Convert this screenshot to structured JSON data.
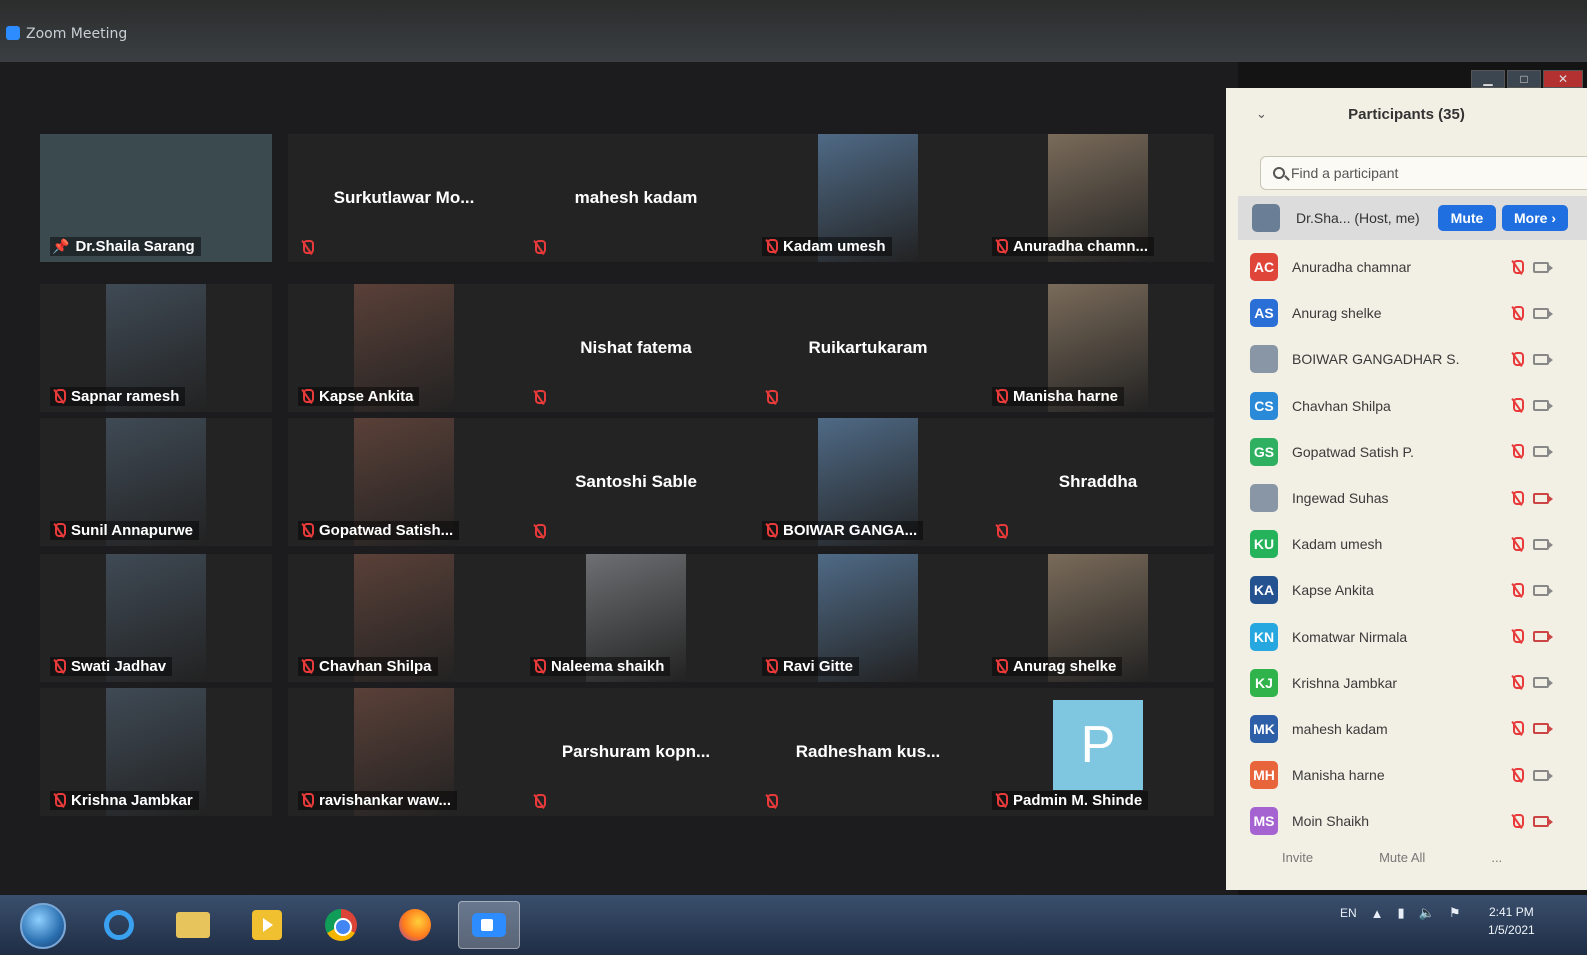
{
  "window": {
    "title": "Zoom Meeting",
    "minimize": "▁",
    "maximize": "□",
    "close": "✕"
  },
  "tiles": [
    {
      "name": "Dr.Shaila Sarang",
      "video": true,
      "active": true,
      "pinned": true
    },
    {
      "name": "Surkutlawar  Mo...",
      "video": false
    },
    {
      "name": "mahesh kadam",
      "video": false
    },
    {
      "name": "Kadam umesh",
      "video": true
    },
    {
      "name": "Anuradha chamn...",
      "video": true
    },
    {
      "name": "Sapnar ramesh",
      "video": true
    },
    {
      "name": "Kapse Ankita",
      "video": true
    },
    {
      "name": "Nishat fatema",
      "video": false
    },
    {
      "name": "Ruikartukaram",
      "video": false
    },
    {
      "name": "Manisha harne",
      "video": true
    },
    {
      "name": "Sunil Annapurwe",
      "video": true
    },
    {
      "name": "Gopatwad Satish...",
      "video": true
    },
    {
      "name": "Santoshi Sable",
      "video": false
    },
    {
      "name": "BOIWAR GANGA...",
      "video": true
    },
    {
      "name": "Shraddha",
      "video": false
    },
    {
      "name": "Swati Jadhav",
      "video": true
    },
    {
      "name": "Chavhan Shilpa",
      "video": true
    },
    {
      "name": "Naleema shaikh",
      "video": true
    },
    {
      "name": "Ravi Gitte",
      "video": true
    },
    {
      "name": "Anurag shelke",
      "video": true
    },
    {
      "name": "Krishna Jambkar",
      "video": true
    },
    {
      "name": "ravishankar waw...",
      "video": true
    },
    {
      "name": "Parshuram  kopn...",
      "video": false
    },
    {
      "name": "Radhesham  kus...",
      "video": false
    },
    {
      "name": "Padmin M. Shinde",
      "video": false,
      "avatar_letter": "P"
    }
  ],
  "panel": {
    "title": "Participants (35)",
    "search_placeholder": "Find a participant",
    "host": {
      "name": "Dr.Sha...  (Host, me)",
      "mute_label": "Mute",
      "more_label": "More ›"
    },
    "participants": [
      {
        "initials": "AC",
        "name": "Anuradha chamnar",
        "color": "#e0453a",
        "cam_off": false
      },
      {
        "initials": "AS",
        "name": "Anurag shelke",
        "color": "#2a6fd6",
        "cam_off": false
      },
      {
        "initials": "",
        "name": "BOIWAR GANGADHAR S.",
        "color": "#8896a6",
        "cam_off": false
      },
      {
        "initials": "CS",
        "name": "Chavhan Shilpa",
        "color": "#2a8ad8",
        "cam_off": false
      },
      {
        "initials": "GS",
        "name": "Gopatwad Satish P.",
        "color": "#2fb060",
        "cam_off": false
      },
      {
        "initials": "",
        "name": "Ingewad Suhas",
        "color": "#8896a6",
        "cam_off": true
      },
      {
        "initials": "KU",
        "name": "Kadam umesh",
        "color": "#24b35a",
        "cam_off": false
      },
      {
        "initials": "KA",
        "name": "Kapse Ankita",
        "color": "#24518f",
        "cam_off": false
      },
      {
        "initials": "KN",
        "name": "Komatwar Nirmala",
        "color": "#26a7e0",
        "cam_off": true
      },
      {
        "initials": "KJ",
        "name": "Krishna Jambkar",
        "color": "#2fb34a",
        "cam_off": false
      },
      {
        "initials": "MK",
        "name": "mahesh kadam",
        "color": "#2c5fa8",
        "cam_off": true
      },
      {
        "initials": "MH",
        "name": "Manisha harne",
        "color": "#e8643a",
        "cam_off": false
      },
      {
        "initials": "MS",
        "name": "Moin Shaikh",
        "color": "#a463d0",
        "cam_off": true
      }
    ],
    "footer": {
      "invite": "Invite",
      "mute_all": "Mute All",
      "more": "..."
    }
  },
  "taskbar": {
    "apps": [
      "internet-explorer",
      "file-explorer",
      "media-player",
      "chrome",
      "firefox",
      "zoom"
    ],
    "language": "EN",
    "time": "2:41 PM",
    "date": "1/5/2021"
  },
  "colors": {
    "active_speaker": "#c6e23b",
    "mute_red": "#e83a3a",
    "accent_blue": "#1f6fe0"
  }
}
